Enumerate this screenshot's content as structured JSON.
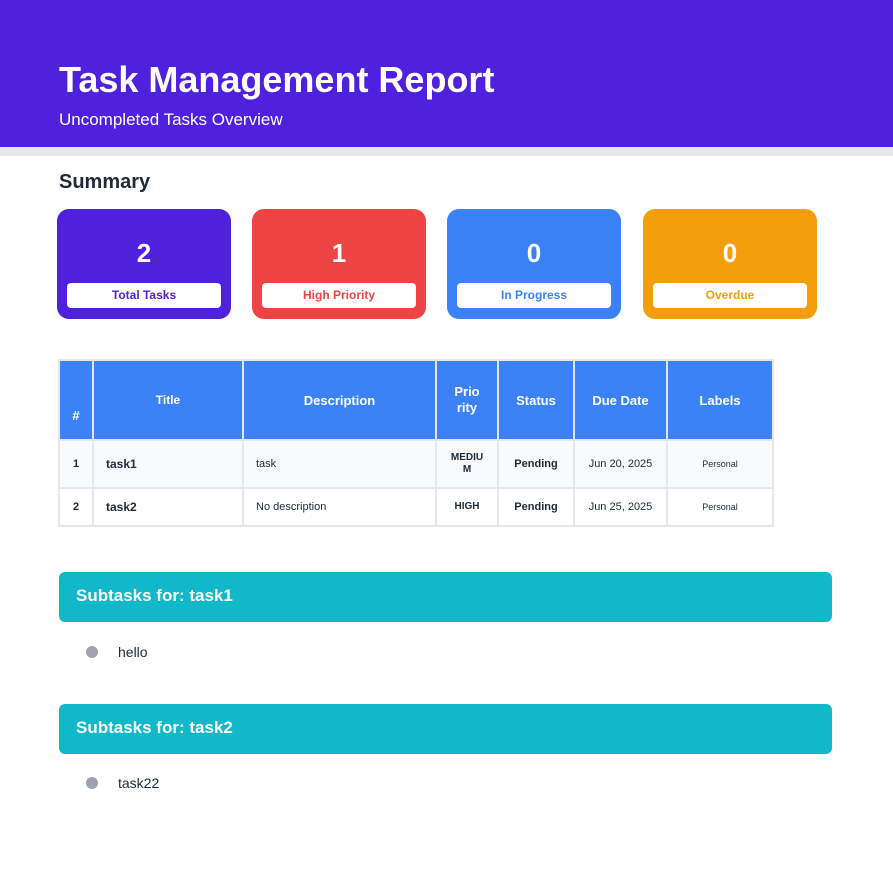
{
  "header": {
    "title": "Task Management Report",
    "subtitle": "Uncompleted Tasks Overview"
  },
  "summary": {
    "heading": "Summary",
    "cards": [
      {
        "value": "2",
        "label": "Total Tasks",
        "color": "#4f21dd"
      },
      {
        "value": "1",
        "label": "High Priority",
        "color": "#ef4444"
      },
      {
        "value": "0",
        "label": "In Progress",
        "color": "#3b82f6"
      },
      {
        "value": "0",
        "label": "Overdue",
        "color": "#f59e0b"
      }
    ]
  },
  "table": {
    "columns": [
      "#",
      "Title",
      "Description",
      "Prio\nrity",
      "Status",
      "Due Date",
      "Labels"
    ],
    "rows": [
      {
        "num": "1",
        "title": "task1",
        "description": "task",
        "priority": "MEDIU\nM",
        "status": "Pending",
        "due": "Jun 20, 2025",
        "labels": "Personal"
      },
      {
        "num": "2",
        "title": "task2",
        "description": "No description",
        "priority": "HIGH",
        "status": "Pending",
        "due": "Jun 25, 2025",
        "labels": "Personal"
      }
    ]
  },
  "subtasks": [
    {
      "heading": "Subtasks for: task1",
      "items": [
        "hello"
      ]
    },
    {
      "heading": "Subtasks for: task2",
      "items": [
        "task22"
      ]
    }
  ],
  "colors": {
    "header": "#4f21dd",
    "table_header": "#3b82f6",
    "subtask_header": "#11b8c9",
    "bullet": "#9ca3af"
  }
}
